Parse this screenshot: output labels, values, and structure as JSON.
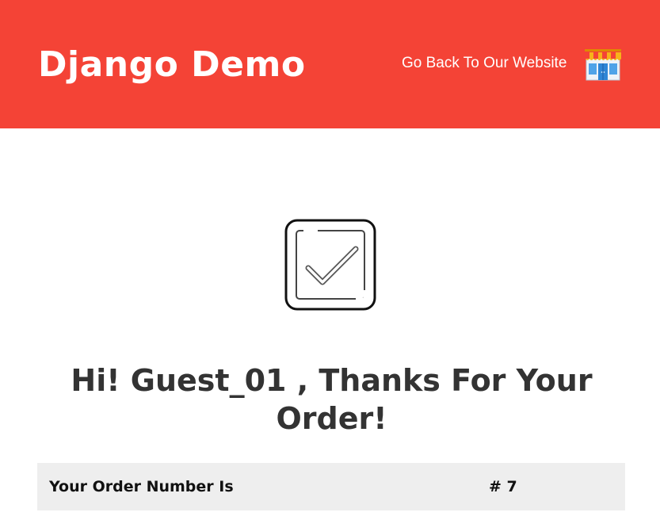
{
  "header": {
    "brand": "Django Demo",
    "back_link": "Go Back To Our Website",
    "store_icon": "store-icon",
    "background_color": "#f44336"
  },
  "main": {
    "check_icon": "check-icon",
    "thanks_message": "Hi! Guest_01 , Thanks For Your Order!",
    "order_label": "Your Order Number Is",
    "order_number": "# 7",
    "text_color": "#333333",
    "row_background": "#eeeeee"
  }
}
